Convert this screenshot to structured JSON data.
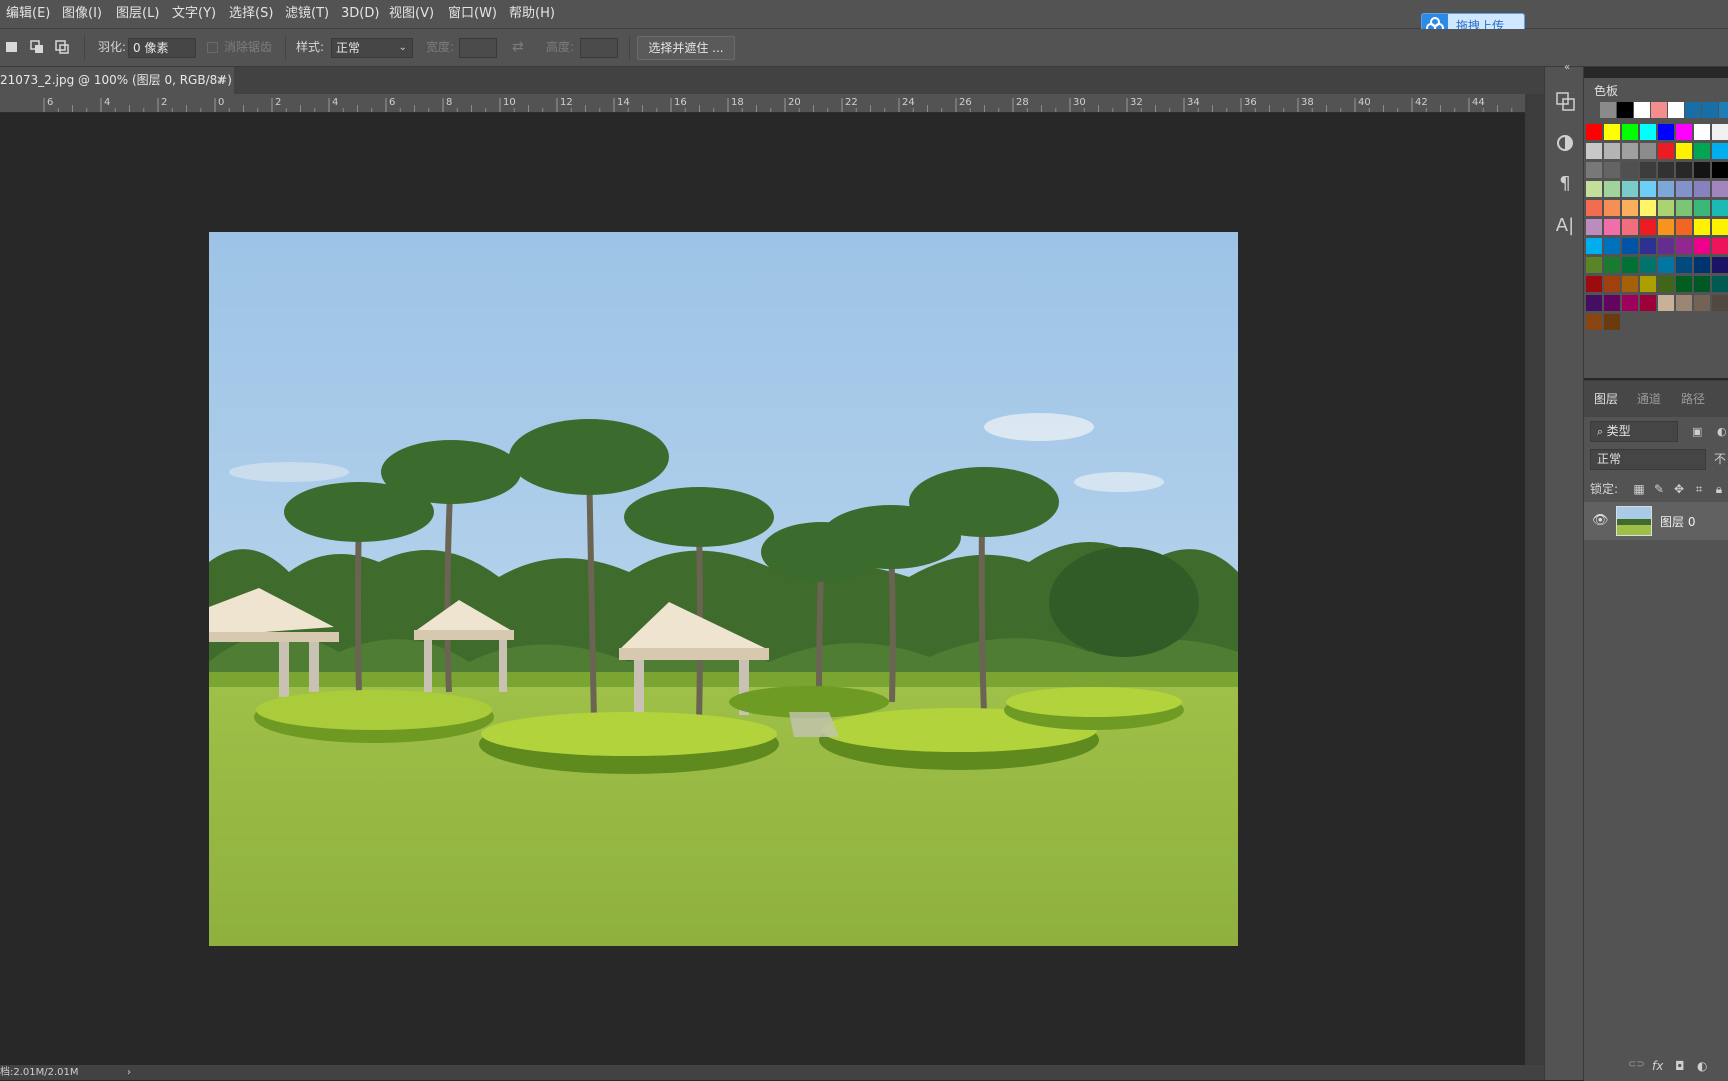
{
  "menu": [
    "编辑(E)",
    "图像(I)",
    "图层(L)",
    "文字(Y)",
    "选择(S)",
    "滤镜(T)",
    "3D(D)",
    "视图(V)",
    "窗口(W)",
    "帮助(H)"
  ],
  "upload_button": {
    "label": "拖拽上传",
    "icon": "cloud-upload-icon"
  },
  "options": {
    "feather_label": "羽化:",
    "feather_value": "0 像素",
    "antialias_label": "消除锯齿",
    "style_label": "样式:",
    "style_value": "正常",
    "width_label": "宽度:",
    "height_label": "高度:",
    "select_mask_button": "选择并遮住 ..."
  },
  "document_tab": {
    "title": "21073_2.jpg @ 100% (图层 0, RGB/8#) *",
    "close": "×"
  },
  "ruler": {
    "labels": [
      "6",
      "4",
      "2",
      "0",
      "2",
      "4",
      "6",
      "8",
      "10",
      "12",
      "14",
      "16",
      "18",
      "20",
      "22",
      "24",
      "26",
      "28",
      "30",
      "32",
      "34",
      "36",
      "38",
      "40",
      "42",
      "44"
    ]
  },
  "status": {
    "text": "档:2.01M/2.01M",
    "arrow": "›"
  },
  "panel_strip_icons": [
    "properties-icon",
    "adjustments-icon",
    "paragraph-icon",
    "character-icon"
  ],
  "swatches_panel": {
    "tab": "色板",
    "recent": [
      "#8a8a8a",
      "#000000",
      "#ffffff",
      "#f48d8d",
      "#ffffff",
      "#1a6ea8",
      "#1a6ea8",
      "#1a7fb8",
      "#1a8ac0"
    ],
    "rows": [
      [
        "#ff0000",
        "#ffff00",
        "#00ff00",
        "#00ffff",
        "#0000ff",
        "#ff00ff",
        "#ffffff",
        "#f0f0f0"
      ],
      [
        "#c8c8c8",
        "#b4b4b4",
        "#a0a0a0",
        "#8c8c8c",
        "#ec1c24",
        "#fff200",
        "#00a651",
        "#00aeef"
      ],
      [
        "#787878",
        "#646464",
        "#505050",
        "#3c3c3c",
        "#323232",
        "#282828",
        "#141414",
        "#000000"
      ],
      [
        "#c4df9b",
        "#a3d39c",
        "#7accc8",
        "#6dcff6",
        "#7da7d9",
        "#8393ca",
        "#8781bd",
        "#a186be"
      ],
      [
        "#f26c4f",
        "#f68e55",
        "#fbaf5c",
        "#fff467",
        "#acd372",
        "#7cc576",
        "#3bb878",
        "#1bbbb4"
      ],
      [
        "#bd8cbf",
        "#f06eaa",
        "#f26d7d",
        "#ed1c24",
        "#f7941d",
        "#f26522",
        "#fff200",
        "#fff200"
      ],
      [
        "#00aeef",
        "#0072bc",
        "#0054a6",
        "#2e3192",
        "#662d91",
        "#92278f",
        "#ec008c",
        "#ed145b"
      ],
      [
        "#598527",
        "#197b30",
        "#007236",
        "#00746b",
        "#0076a3",
        "#004a80",
        "#003471",
        "#1b1464"
      ],
      [
        "#9e0b0f",
        "#a0410d",
        "#a36209",
        "#aba000",
        "#406618",
        "#005e20",
        "#005826",
        "#005952"
      ],
      [
        "#440e62",
        "#630460",
        "#9e005d",
        "#9e0039",
        "#c7b299",
        "#998675",
        "#736357",
        "#534741"
      ],
      [
        "#8b4513",
        "#6b3a0f"
      ]
    ]
  },
  "layers_panel": {
    "tabs": [
      "图层",
      "通道",
      "路径"
    ],
    "filter_type": "类型",
    "blend_mode": "正常",
    "opacity_label": "不",
    "lock_label": "锁定:",
    "layer_name": "图层 0",
    "footer_icons": [
      "link-icon",
      "fx-icon",
      "mask-icon",
      "adjustment-layer-icon"
    ],
    "footer_fx": "fx"
  }
}
